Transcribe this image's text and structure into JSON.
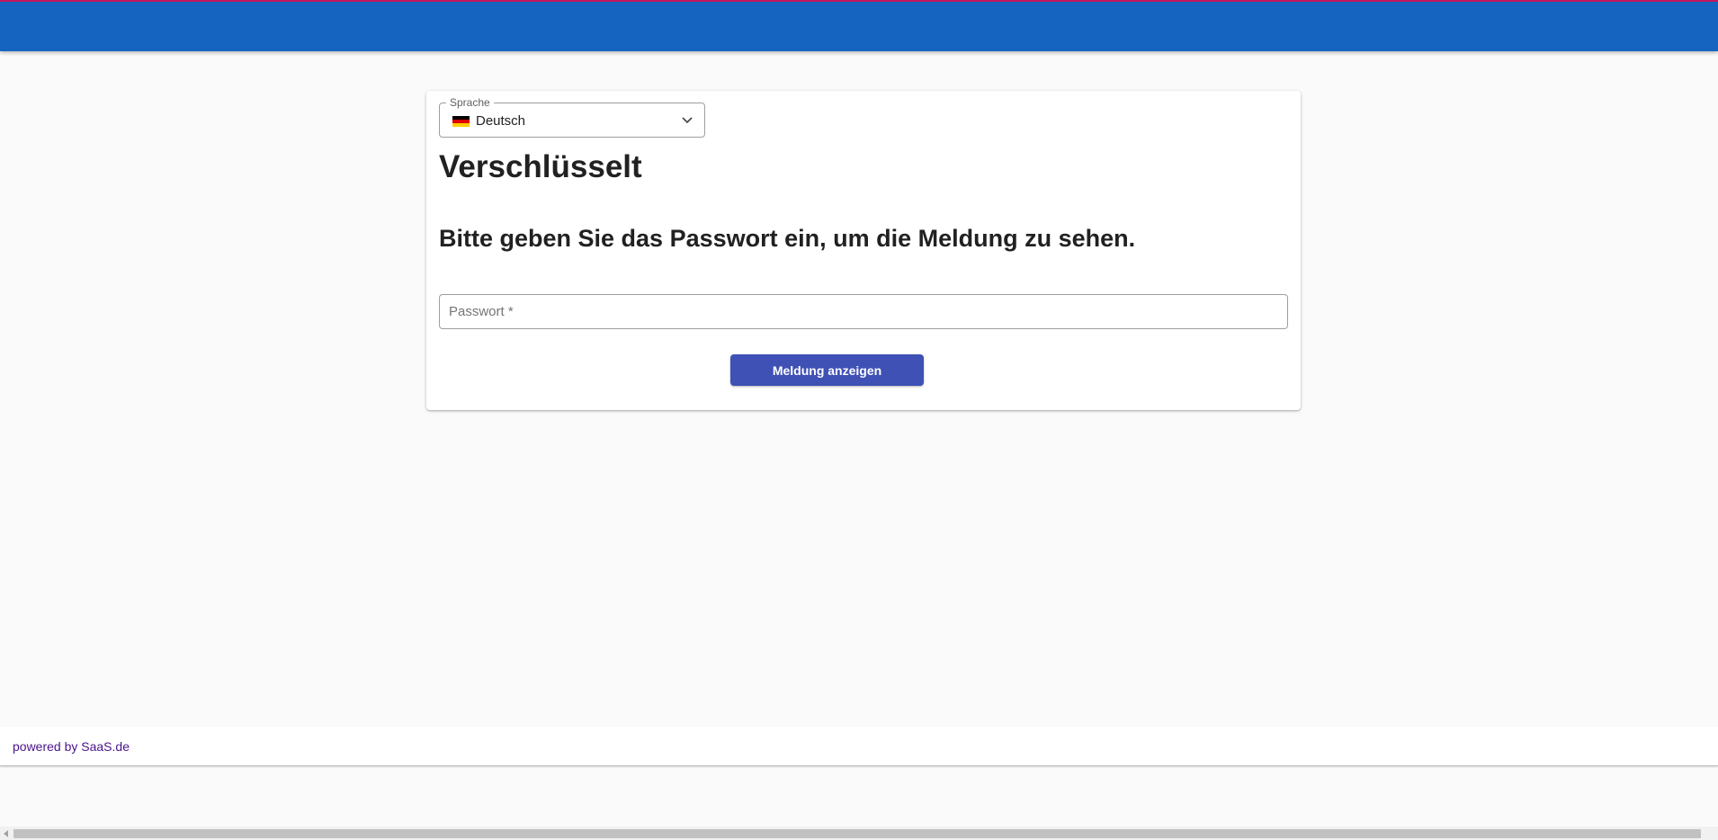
{
  "header": {
    "color": "#1565c0",
    "accent_line_color": "#c2185b"
  },
  "language": {
    "label": "Sprache",
    "selected": "Deutsch",
    "flag_icon": "germany-flag-icon"
  },
  "content": {
    "title": "Verschlüsselt",
    "subtitle": "Bitte geben Sie das Passwort ein, um die Meldung zu sehen.",
    "password_placeholder": "Passwort *",
    "submit_label": "Meldung anzeigen",
    "submit_color": "#3f51b5"
  },
  "footer": {
    "text": "powered by SaaS.de",
    "link_color": "#4a148c"
  }
}
